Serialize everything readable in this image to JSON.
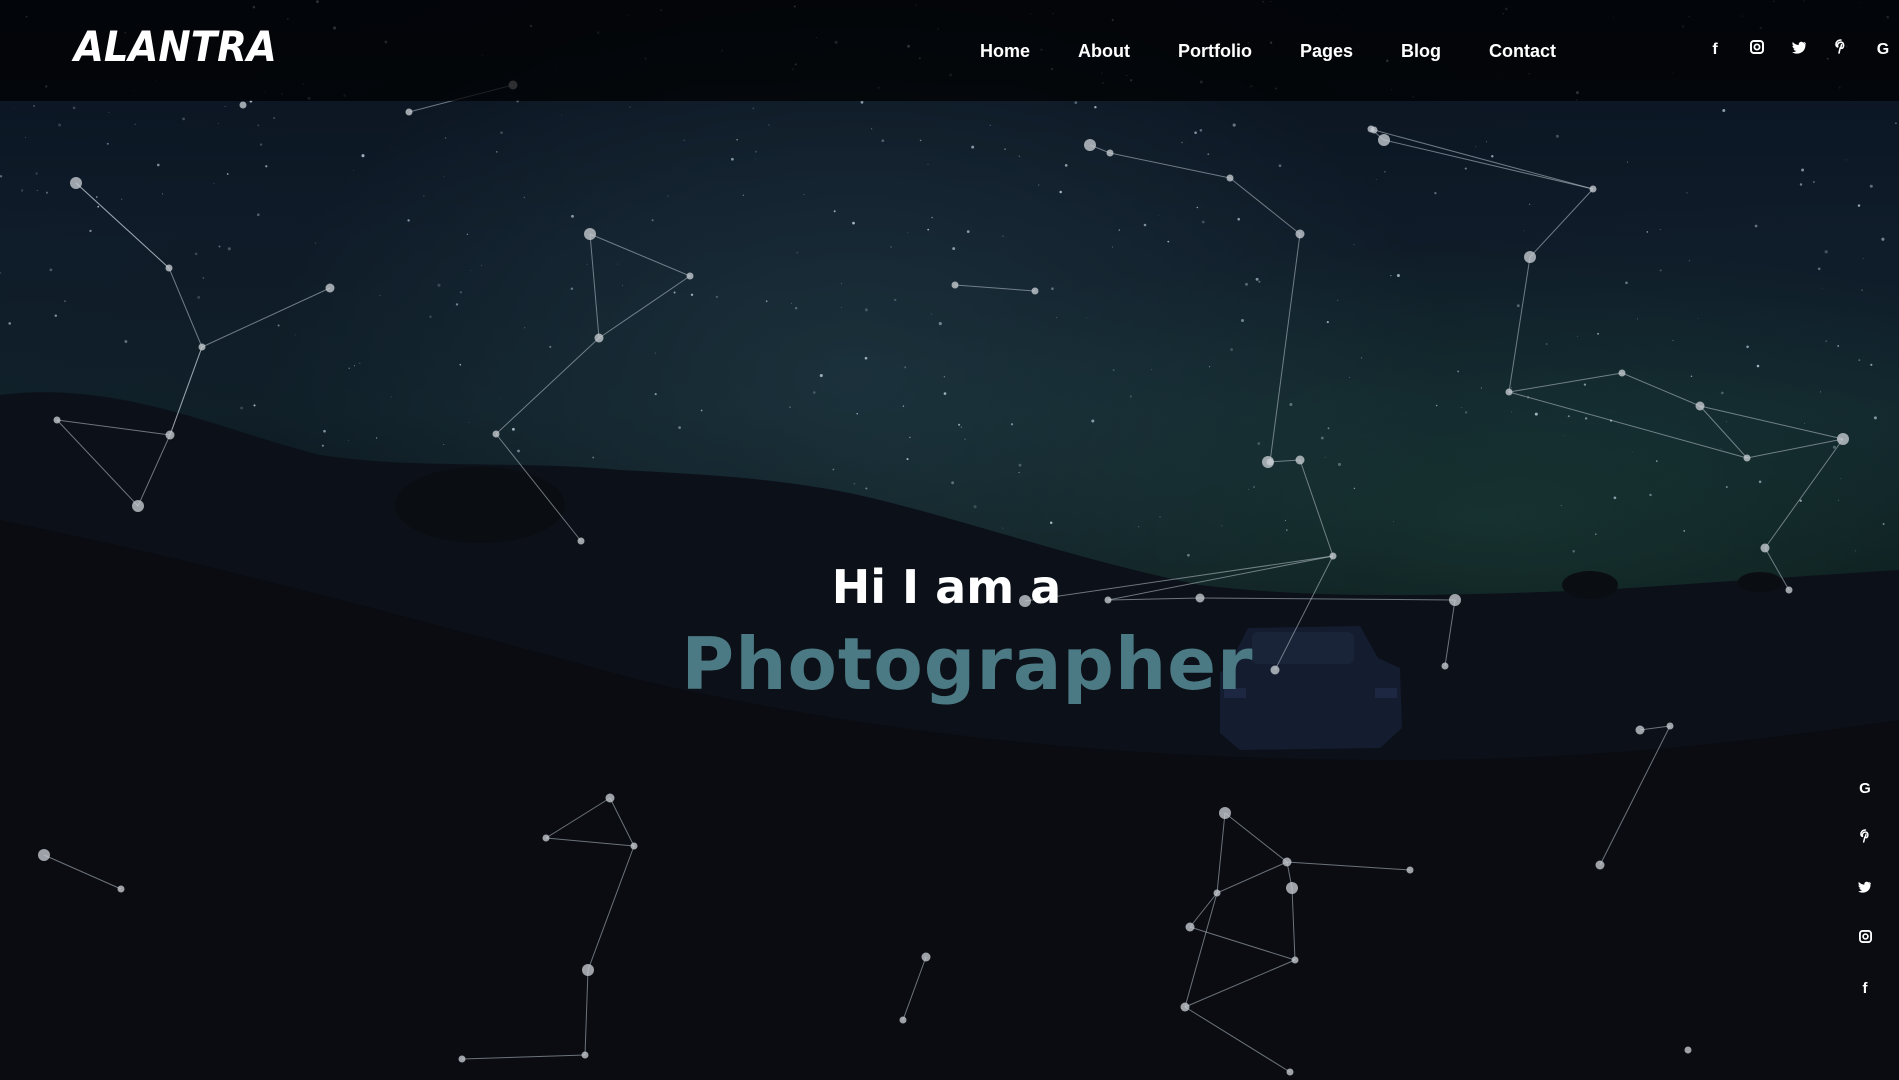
{
  "brand": {
    "logo": "ALANTRA"
  },
  "nav": {
    "items": [
      "Home",
      "About",
      "Portfolio",
      "Pages",
      "Blog",
      "Contact"
    ]
  },
  "social_top": {
    "icons": [
      {
        "name": "facebook-icon",
        "glyph": "f"
      },
      {
        "name": "instagram-icon",
        "glyph": "▣"
      },
      {
        "name": "twitter-icon",
        "glyph": "🐦"
      },
      {
        "name": "pinterest-icon",
        "glyph": "P"
      },
      {
        "name": "google-icon",
        "glyph": "G"
      }
    ]
  },
  "social_side": {
    "icons": [
      {
        "name": "google-icon",
        "glyph": "G"
      },
      {
        "name": "pinterest-icon",
        "glyph": "P"
      },
      {
        "name": "twitter-icon",
        "glyph": "🐦"
      },
      {
        "name": "instagram-icon",
        "glyph": "▣"
      },
      {
        "name": "facebook-icon",
        "glyph": "f"
      }
    ]
  },
  "hero": {
    "intro": "Hi I am a",
    "role": "Photographer"
  },
  "colors": {
    "accent": "#4c7a84",
    "header_bg": "#000000"
  }
}
